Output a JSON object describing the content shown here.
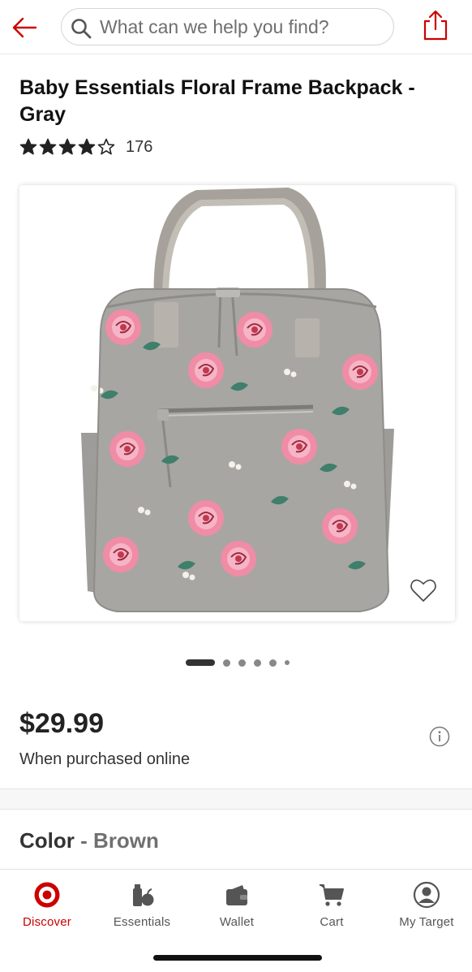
{
  "header": {
    "back_icon": "arrow-left-icon",
    "search_placeholder": "What can we help you find?",
    "share_icon": "share-icon",
    "accent_color": "#cc0000"
  },
  "product": {
    "title": "Baby Essentials Floral Frame Backpack - Gray",
    "rating": 4,
    "rating_max": 5,
    "rating_count": "176",
    "image": "gray-floral-backpack",
    "image_index": 1,
    "image_total": 6,
    "price": "$29.99",
    "price_note": "When purchased online",
    "color_label": "Color",
    "color_separator": "-",
    "color_value": "Brown"
  },
  "tabbar": {
    "tabs": [
      {
        "label": "Discover",
        "icon": "target-logo-icon",
        "active": true
      },
      {
        "label": "Essentials",
        "icon": "essentials-icon",
        "active": false
      },
      {
        "label": "Wallet",
        "icon": "wallet-icon",
        "active": false
      },
      {
        "label": "Cart",
        "icon": "cart-icon",
        "active": false
      },
      {
        "label": "My Target",
        "icon": "account-icon",
        "active": false
      }
    ]
  }
}
